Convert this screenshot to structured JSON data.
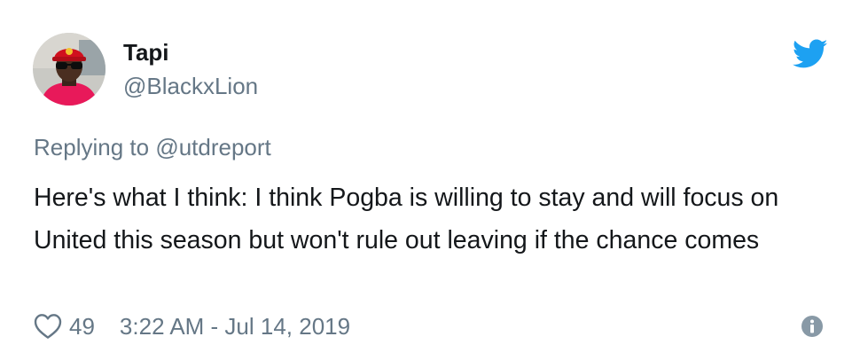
{
  "author": {
    "display_name": "Tapi",
    "handle": "@BlackxLion"
  },
  "reply": {
    "prefix": "Replying to ",
    "mention": "@utdreport"
  },
  "tweet": {
    "text": "Here's what I think: I think Pogba is willing to stay and will focus on United this season but won't rule out leaving if the chance comes"
  },
  "meta": {
    "likes": "49",
    "timestamp": "3:22 AM - Jul 14, 2019"
  },
  "icons": {
    "brand": "twitter-bird-icon",
    "like": "heart-icon",
    "info": "info-icon"
  },
  "colors": {
    "brand": "#1da1f2",
    "secondary_text": "#657786",
    "primary_text": "#14171a"
  }
}
